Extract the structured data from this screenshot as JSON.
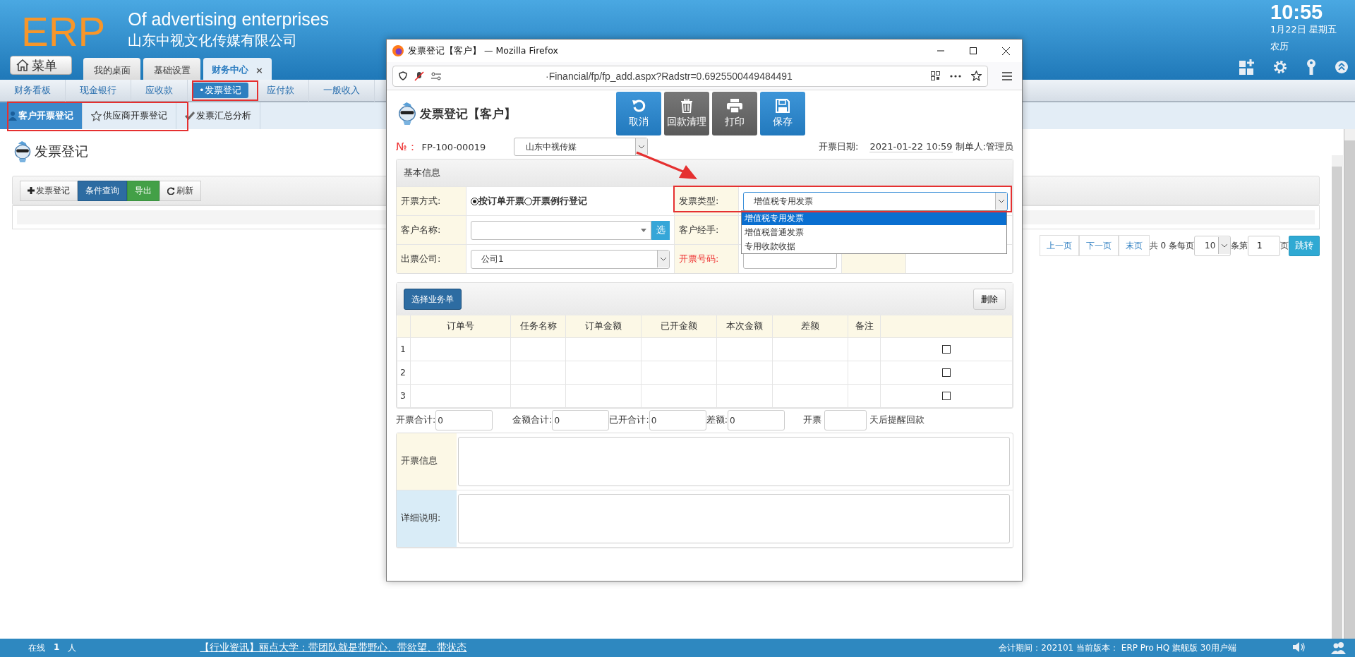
{
  "header": {
    "logo": "ERP",
    "title": "Of advertising enterprises",
    "company": "山东中视文化传媒有限公司",
    "time": "10:55",
    "date": "1月22日 星期五",
    "lunar": "农历"
  },
  "menu_button": "菜单",
  "tabs": [
    {
      "label": "我的桌面",
      "selected": false
    },
    {
      "label": "基础设置",
      "selected": false
    },
    {
      "label": "财务中心",
      "selected": true,
      "close": "×"
    }
  ],
  "nav": [
    {
      "label": "财务看板",
      "selected": false
    },
    {
      "label": "现金银行",
      "selected": false
    },
    {
      "label": "应收款",
      "selected": false
    },
    {
      "label": "•发票登记",
      "selected": true
    },
    {
      "label": "应付款",
      "selected": false
    },
    {
      "label": "一般收入",
      "selected": false
    }
  ],
  "subtabs": [
    {
      "label": "客户开票登记",
      "selected": true,
      "kind": "person"
    },
    {
      "label": "供应商开票登记",
      "selected": false,
      "kind": "star"
    },
    {
      "label": "发票汇总分析",
      "selected": false,
      "kind": "check"
    }
  ],
  "page_title": "发票登记",
  "toolbar": [
    {
      "label": "发票登记",
      "kind": "add"
    },
    {
      "label": "条件查询",
      "kind": "primary"
    },
    {
      "label": "导出",
      "kind": "success"
    },
    {
      "label": "刷新",
      "kind": "refresh"
    }
  ],
  "pager": {
    "links": [
      "上一页",
      "下一页",
      "末页"
    ],
    "total": "共 0 条每页",
    "page_size": "10",
    "page_label": "条第",
    "page": "1",
    "page_unit": "页",
    "go": "跳转"
  },
  "popup": {
    "title": "发票登记【客户】 — Mozilla Firefox",
    "url": "·Financial/fp/fp_add.aspx?Radstr=0.6925500449484491",
    "heading": "发票登记【客户】",
    "actions": [
      {
        "label": "取消",
        "kind": "cancel"
      },
      {
        "label": "回款清理",
        "kind": "clear"
      },
      {
        "label": "打印",
        "kind": "print"
      },
      {
        "label": "保存",
        "kind": "save"
      }
    ],
    "no_label": "№：",
    "no": "FP-100-00019",
    "company_select": "山东中视传媒",
    "date_label": "开票日期:",
    "date": "2021-01-22 10:59",
    "maker_label": "制单人:",
    "maker": "管理员",
    "section": "基本信息",
    "method_label": "开票方式:",
    "methods": [
      {
        "label": "按订单开票",
        "selected": true
      },
      {
        "label": "开票例行登记",
        "selected": false
      }
    ],
    "type_label": "发票类型:",
    "type_value": "增值税专用发票",
    "type_options": [
      {
        "label": "增值税专用发票",
        "selected": true
      },
      {
        "label": "增值税普通发票",
        "selected": false
      },
      {
        "label": "专用收款收据",
        "selected": false
      }
    ],
    "customer_label": "客户名称:",
    "pick": "选",
    "handler_label": "客户经手:",
    "issuer_label": "出票公司:",
    "issuer": "公司1",
    "invoice_no_label": "开票号码:",
    "select_orders": "选择业务单",
    "delete": "删除",
    "columns": [
      "订单号",
      "任务名称",
      "订单金额",
      "已开金额",
      "本次金额",
      "差额",
      "备注"
    ],
    "rows": [
      {
        "index": "1",
        "checked": false
      },
      {
        "index": "2",
        "checked": false
      },
      {
        "index": "3",
        "checked": false
      }
    ],
    "totals": [
      {
        "label": "开票合计:",
        "value": "0"
      },
      {
        "label": "金额合计:",
        "value": "0"
      },
      {
        "label": "已开合计:",
        "value": "0"
      },
      {
        "label": "差额:",
        "value": "0"
      }
    ],
    "remind_before": "开票",
    "remind_after": "天后提醒回款",
    "notes": [
      {
        "label": "开票信息",
        "kind": "info"
      },
      {
        "label": "详细说明:",
        "kind": "detail"
      }
    ]
  },
  "status_bar": {
    "online_label": "在线",
    "online_count": "1",
    "online_unit": "人",
    "news": "【行业资讯】丽点大学：带团队就是带野心、带欲望、带状态",
    "info": "会计期间：202101 当前版本： ERP Pro HQ 旗舰版 30用户端"
  }
}
